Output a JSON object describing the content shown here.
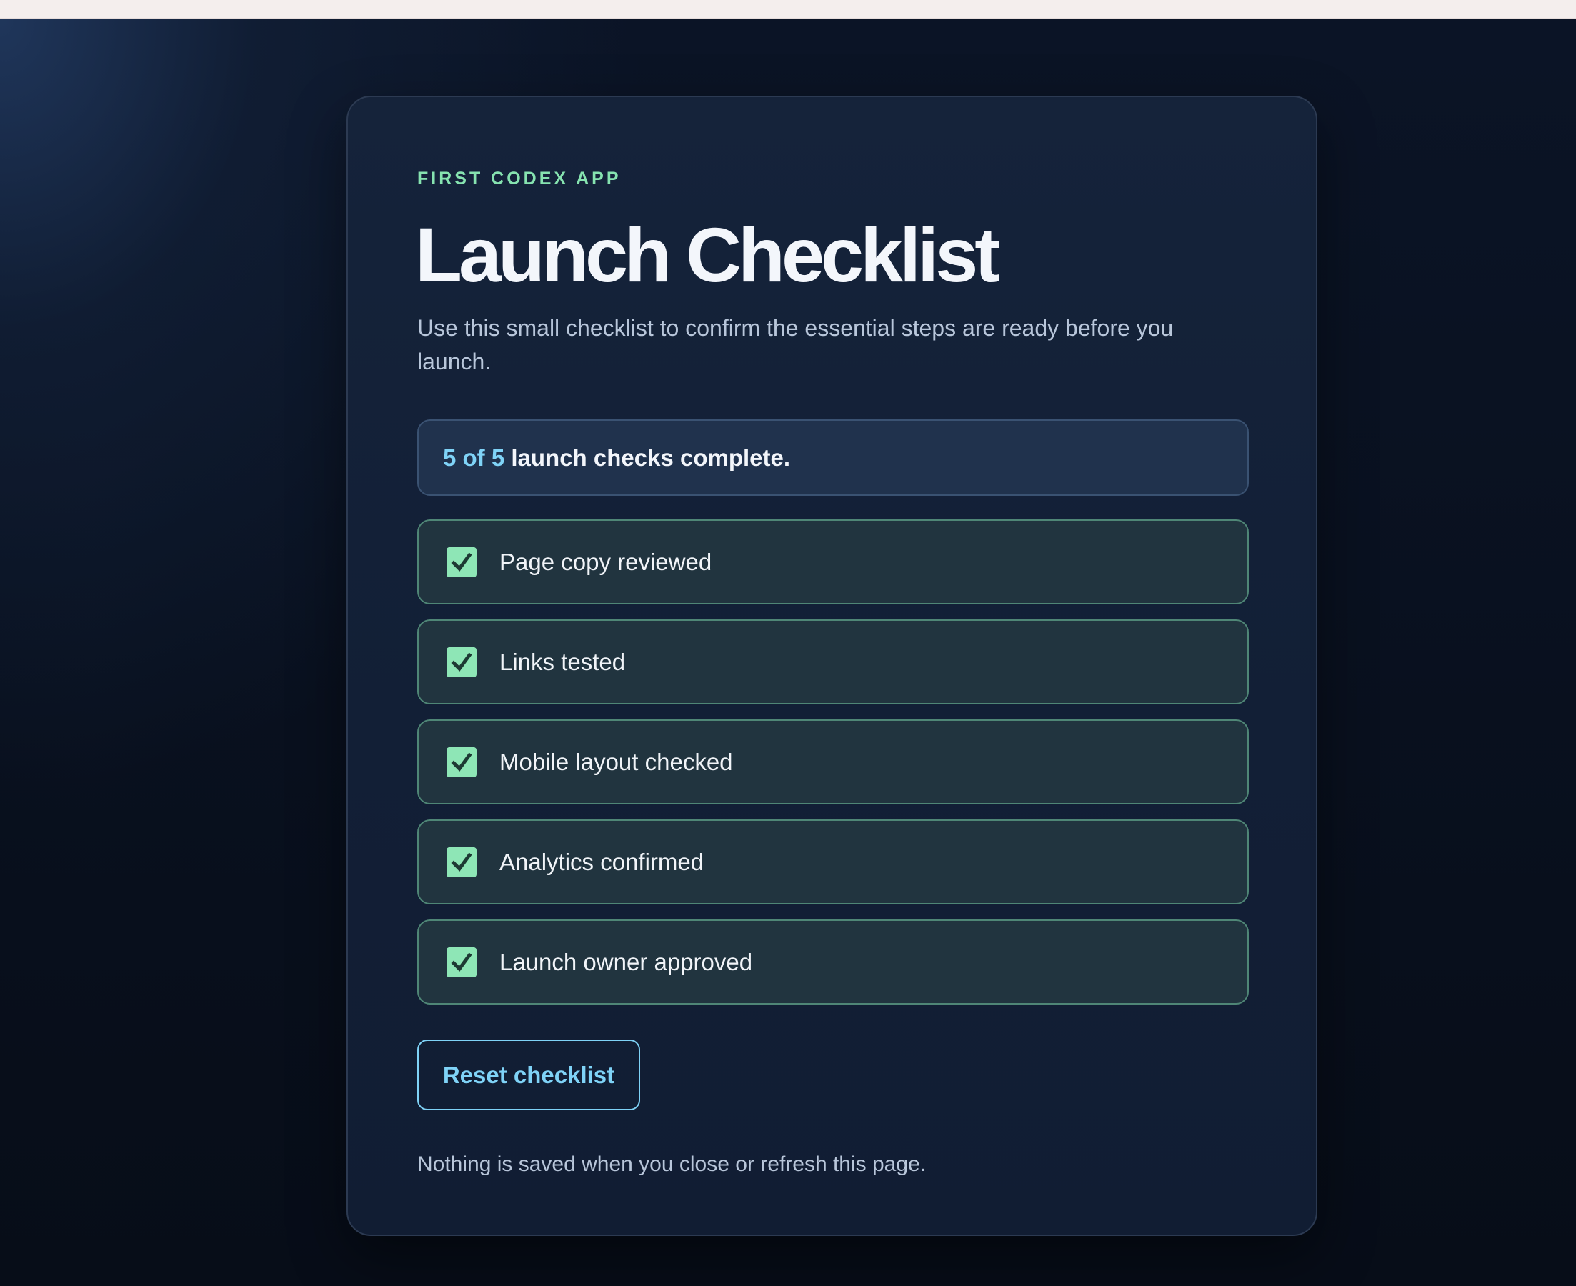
{
  "header": {
    "eyebrow": "FIRST CODEX APP",
    "title": "Launch Checklist",
    "subtitle": "Use this small checklist to confirm the essential steps are ready before you launch."
  },
  "progress": {
    "count_text": "5 of 5",
    "suffix_text": " launch checks complete.",
    "completed": 5,
    "total": 5
  },
  "checklist": {
    "items": [
      {
        "label": "Page copy reviewed",
        "checked": true
      },
      {
        "label": "Links tested",
        "checked": true
      },
      {
        "label": "Mobile layout checked",
        "checked": true
      },
      {
        "label": "Analytics confirmed",
        "checked": true
      },
      {
        "label": "Launch owner approved",
        "checked": true
      }
    ]
  },
  "actions": {
    "reset_label": "Reset checklist"
  },
  "footer": {
    "note": "Nothing is saved when you close or refresh this page."
  },
  "colors": {
    "accent_green": "#8ee6b6",
    "accent_blue": "#7fd3f7",
    "card_background": "#15233a",
    "page_background": "#080f1c"
  },
  "icons": {
    "checkbox": "checkmark-icon"
  }
}
